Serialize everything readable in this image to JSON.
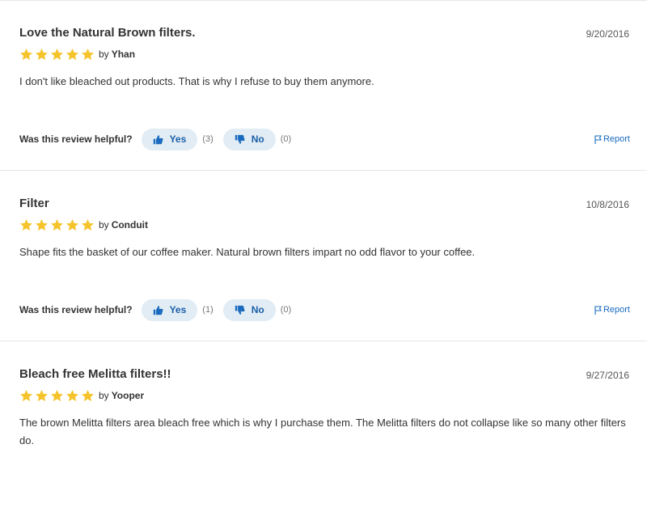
{
  "colors": {
    "star": "#f5c42c",
    "vote_button_bg": "#e1ecf4",
    "accent_blue": "#1a6bbf",
    "divider": "#e6e6e6"
  },
  "helpful_prompt": "Was this review helpful?",
  "reviews": [
    {
      "title": "Love the Natural Brown filters.",
      "date": "9/20/2016",
      "rating": 5,
      "by": "by",
      "author": "Yhan",
      "body": "I don't like bleached out products. That is why I refuse to buy them anymore.",
      "yes_label": "Yes",
      "yes_count": "(3)",
      "no_label": "No",
      "no_count": "(0)",
      "report_label": "Report"
    },
    {
      "title": "Filter",
      "date": "10/8/2016",
      "rating": 5,
      "by": "by",
      "author": "Conduit",
      "body": "Shape fits the basket of our coffee maker. Natural brown filters impart no odd flavor to your coffee.",
      "yes_label": "Yes",
      "yes_count": "(1)",
      "no_label": "No",
      "no_count": "(0)",
      "report_label": "Report"
    },
    {
      "title": "Bleach free Melitta filters!!",
      "date": "9/27/2016",
      "rating": 5,
      "by": "by",
      "author": "Yooper",
      "body": "The brown Melitta filters area bleach free which is why I purchase them. The Melitta filters do not collapse like so many other filters do."
    }
  ]
}
